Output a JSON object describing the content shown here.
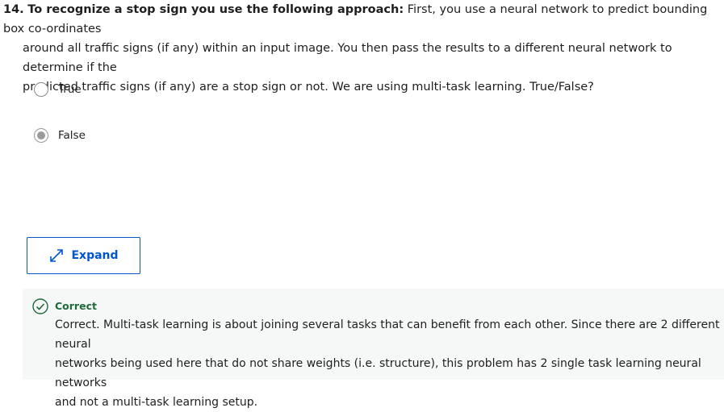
{
  "question": {
    "number": "14.",
    "lead": "To recognize a stop sign you use the following approach:",
    "line1_rest": "First, you use a neural network to predict bounding box co-ordinates",
    "line2": "around all traffic signs (if any) within an input image. You then pass the results to a different neural network to determine if the",
    "line3": "predicted traffic signs (if any) are a stop sign or not. We are using multi-task learning. True/False?"
  },
  "options": [
    {
      "label": "True",
      "selected": false
    },
    {
      "label": "False",
      "selected": true
    }
  ],
  "expand": {
    "label": "Expand",
    "icon": "expand-icon"
  },
  "feedback": {
    "status": "Correct",
    "icon": "check-circle-icon",
    "color": "#1e6b3a",
    "line1": "Correct. Multi-task learning is about joining several tasks that can benefit from each other. Since there are 2 different neural",
    "line2": "networks being used here that do not share weights (i.e. structure), this problem has 2 single task learning neural networks",
    "line3": "and not a multi-task learning setup."
  },
  "colors": {
    "accent": "#0056d2",
    "success": "#1e6b3a",
    "feedback_bg": "#f5f8f6"
  }
}
